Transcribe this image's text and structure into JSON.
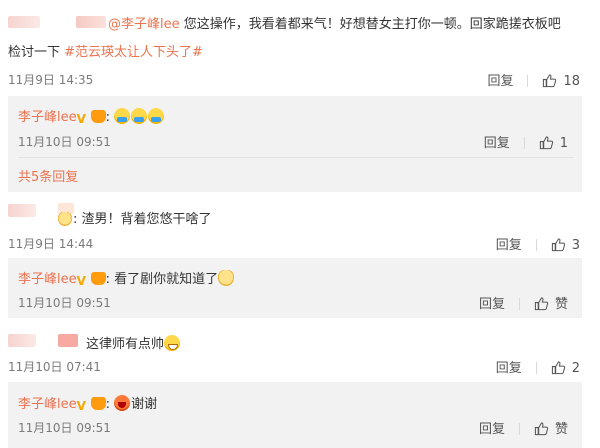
{
  "comments": [
    {
      "text": "@李子峰lee 您这操作，我看着都来气！好想替女主打你一顿。回家跪搓衣板吧",
      "text_line2_plain": "检讨一下 ",
      "hashtag": "#范云瑛太让人下头了#",
      "time": "11月9日 14:35",
      "reply_label": "回复",
      "like_count": "18"
    },
    {
      "text": "渣男！背着您悠干啥了",
      "time": "11月9日 14:44",
      "reply_label": "回复",
      "like_count": "3"
    },
    {
      "text": "这律师有点帅",
      "time": "11月10日 07:41",
      "reply_label": "回复",
      "like_count": "2"
    }
  ],
  "replies": [
    {
      "username": "李子峰lee",
      "text": "",
      "time": "11月10日 09:51",
      "reply_label": "回复",
      "like_count": "1",
      "more_replies": "共5条回复"
    },
    {
      "username": "李子峰lee",
      "text": "看了剧你就知道了",
      "time": "11月10日 09:51",
      "reply_label": "回复",
      "like_label": "赞"
    },
    {
      "username": "李子峰lee",
      "text": "谢谢",
      "time": "11月10日 09:51",
      "reply_label": "回复",
      "like_label": "赞"
    }
  ],
  "colors": {
    "accent": "#eb7350",
    "reply_bg": "#f2f2f2",
    "vip": "#f7a600"
  },
  "icons": [
    "thumbs-up-icon",
    "crying-emoji-icon",
    "grin-emoji-icon",
    "laugh-emoji-icon",
    "cat-emoji-icon",
    "vip-badge-icon",
    "crown-badge-icon"
  ]
}
